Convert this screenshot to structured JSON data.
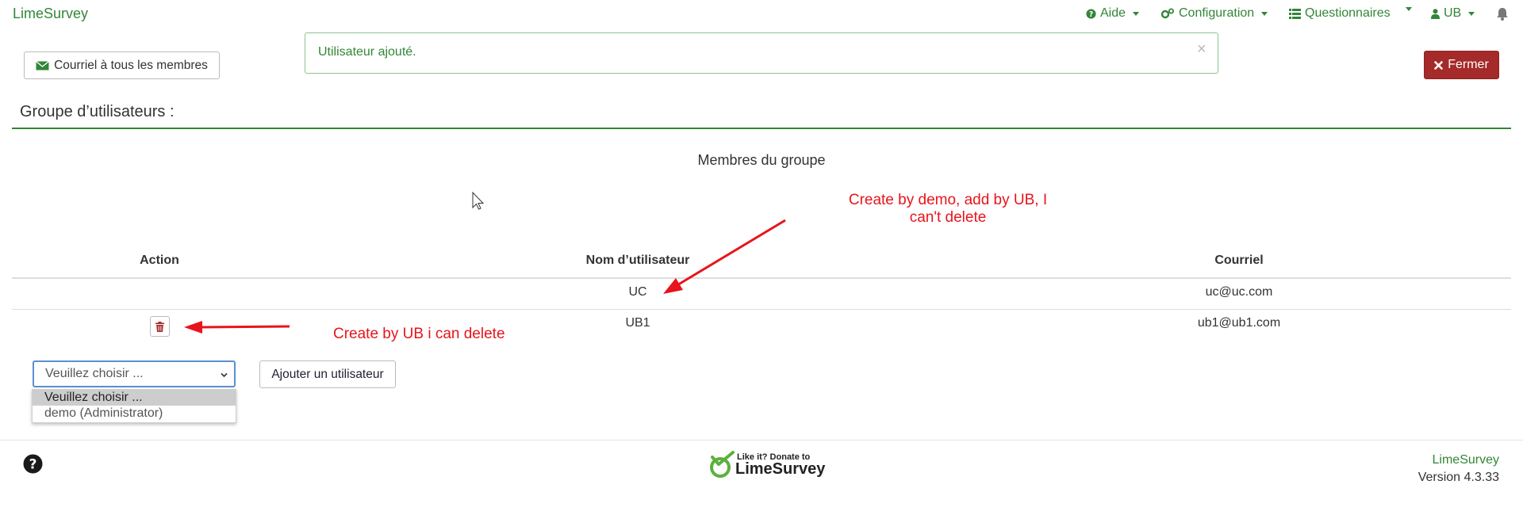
{
  "app": {
    "brand": "LimeSurvey"
  },
  "navbar": {
    "help_label": "Aide",
    "config_label": "Configuration",
    "surveys_label": "Questionnaires",
    "user_label": "UB"
  },
  "toolbar": {
    "mail_label": "Courriel à tous les membres",
    "close_label": "Fermer"
  },
  "alert": {
    "message": "Utilisateur ajouté.",
    "close_glyph": "×"
  },
  "group": {
    "title": "Groupe d’utilisateurs :",
    "members_title": "Membres du groupe",
    "columns": [
      "Action",
      "Nom d’utilisateur",
      "Courriel"
    ],
    "rows": [
      {
        "username": "UC",
        "email": "uc@uc.com",
        "deletable": false
      },
      {
        "username": "UB1",
        "email": "ub1@ub1.com",
        "deletable": true
      }
    ]
  },
  "add_user": {
    "select_value": "Veuillez choisir ...",
    "options": [
      "Veuillez choisir ...",
      "demo (Administrator)"
    ],
    "button_label": "Ajouter un utilisateur"
  },
  "annotations": {
    "top_line1": "Create by demo, add by UB, I",
    "top_line2": "can't delete",
    "bottom": "Create by UB i can delete"
  },
  "footer": {
    "donate_small": "Like it? Donate to",
    "donate_brand": "LimeSurvey",
    "brand": "LimeSurvey",
    "version": "Version 4.3.33"
  },
  "colors": {
    "brand_green": "#328637",
    "danger": "#a52a2a",
    "annotation_red": "#e8141b"
  },
  "icons": [
    "help-icon",
    "gears-icon",
    "list-icon",
    "user-icon",
    "bell-icon",
    "envelope-icon",
    "close-icon",
    "trash-icon",
    "question-circle-icon",
    "chevron-down-icon"
  ]
}
